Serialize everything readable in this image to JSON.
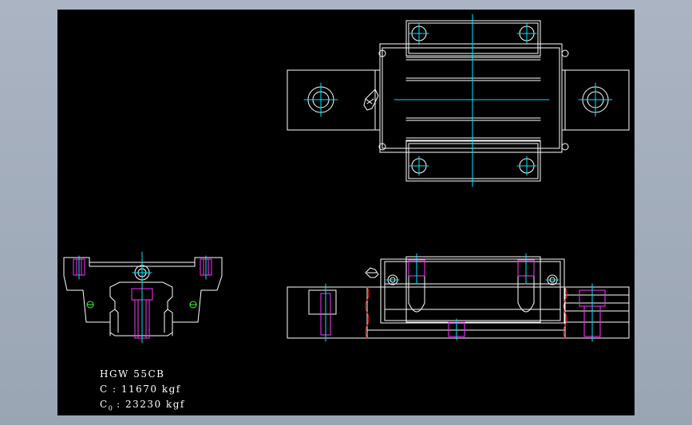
{
  "drawing": {
    "colors": {
      "background": "#000000",
      "outline": "#ffffff",
      "centerline": "#00e5ff",
      "hidden": "#ff33ff",
      "grease": "#33ff33",
      "break": "#ff2020"
    },
    "specs": {
      "model": "HGW 55CB",
      "dynamic_label": "C : 11670 kgf",
      "static_prefix": "C",
      "static_sub": "0",
      "static_value": ": 23230 kgf"
    }
  }
}
